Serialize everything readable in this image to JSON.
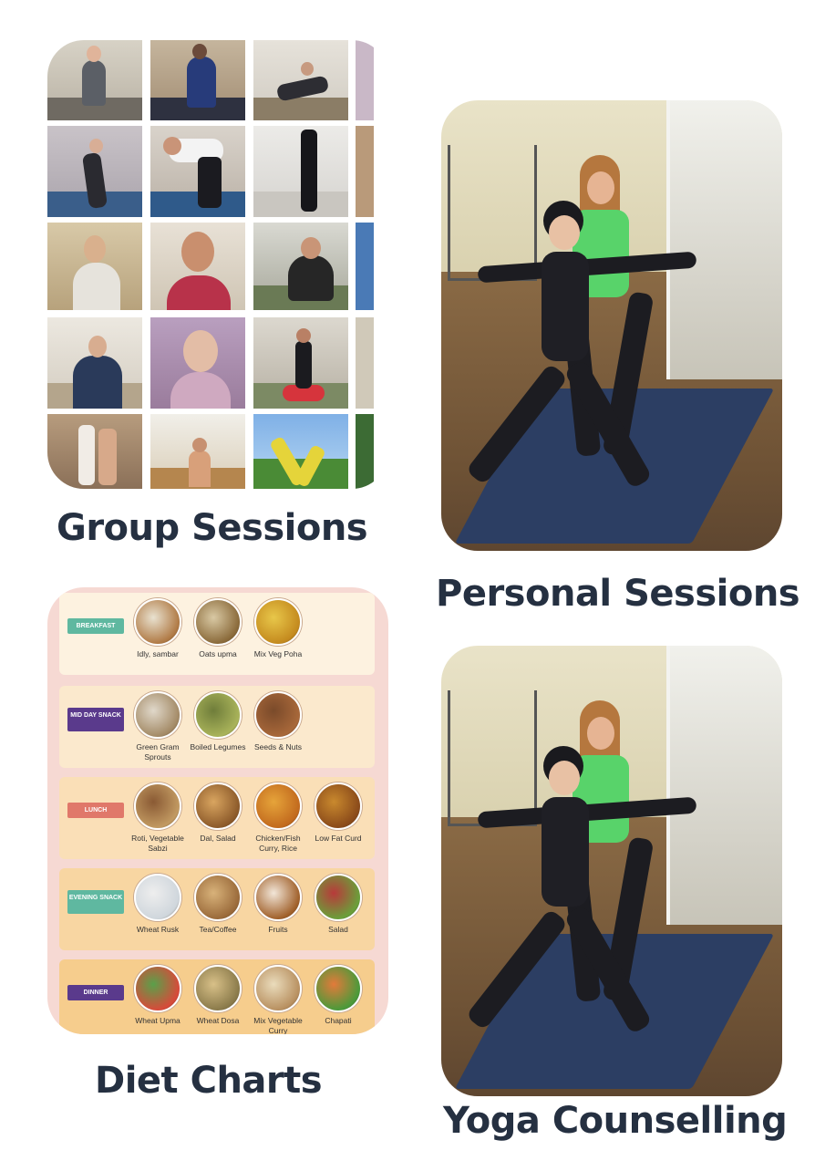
{
  "captions": {
    "group": "Group Sessions",
    "personal": "Personal Sessions",
    "diet": "Diet Charts",
    "counselling": "Yoga Counselling"
  },
  "diet_chart": {
    "meals": [
      {
        "tag": "BREAKFAST",
        "tag_color": "#5fb8a0",
        "foods": [
          "Idly, sambar",
          "Oats upma",
          "Mix Veg Poha"
        ]
      },
      {
        "tag": "MID DAY SNACK",
        "tag_color": "#5a3a8c",
        "foods": [
          "Green Gram Sprouts",
          "Boiled Legumes",
          "Seeds & Nuts"
        ]
      },
      {
        "tag": "LUNCH",
        "tag_color": "#e0786a",
        "foods": [
          "Roti, Vegetable Sabzi",
          "Dal, Salad",
          "Chicken/Fish Curry, Rice",
          "Low Fat Curd"
        ]
      },
      {
        "tag": "EVENING SNACK",
        "tag_color": "#5fb8a0",
        "foods": [
          "Wheat Rusk",
          "Tea/Coffee",
          "Fruits",
          "Salad"
        ]
      },
      {
        "tag": "DINNER",
        "tag_color": "#5a3a8c",
        "foods": [
          "Wheat Upma",
          "Wheat Dosa",
          "Mix Vegetable Curry",
          "Chapati"
        ]
      }
    ]
  }
}
